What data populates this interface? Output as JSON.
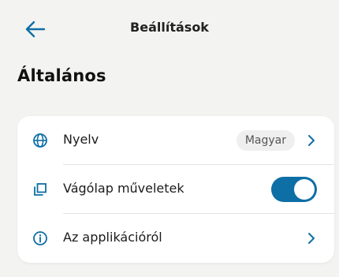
{
  "header": {
    "title": "Beállítások",
    "back_icon": "arrow-left-icon"
  },
  "section": {
    "title": "Általános"
  },
  "settings": {
    "items": [
      {
        "label": "Nyelv",
        "icon": "globe-icon",
        "value": "Magyar",
        "control": "chevron"
      },
      {
        "label": "Vágólap műveletek",
        "icon": "copy-icon",
        "control": "toggle",
        "enabled": true
      },
      {
        "label": "Az applikációról",
        "icon": "info-icon",
        "control": "chevron"
      }
    ]
  },
  "colors": {
    "accent": "#0e6fa6",
    "background": "#f3f3f1",
    "card": "#ffffff"
  }
}
